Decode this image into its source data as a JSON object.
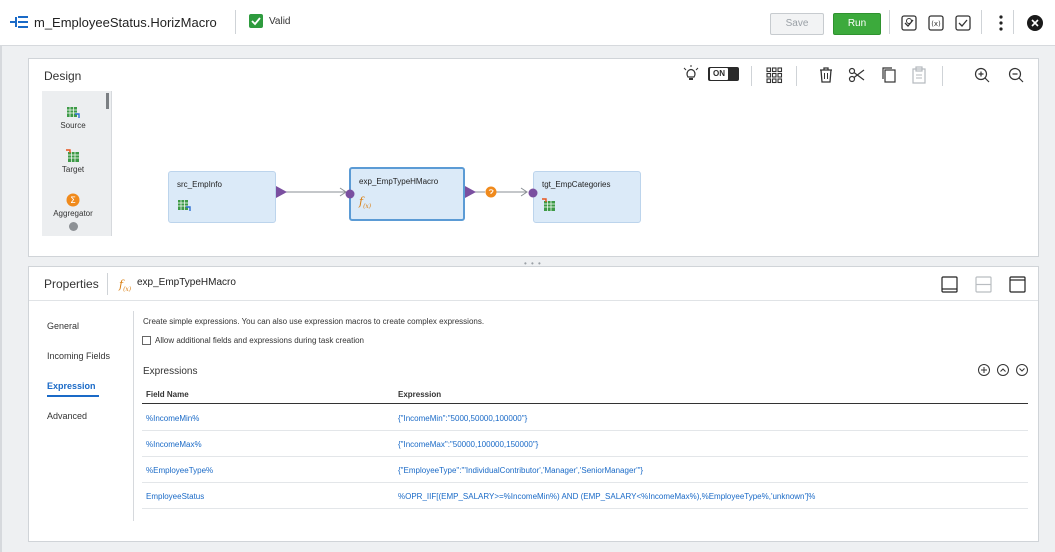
{
  "header": {
    "title": "m_EmployeeStatus.HorizMacro",
    "status_label": "Valid",
    "save_label": "Save",
    "run_label": "Run",
    "icons": [
      "mapping-icon",
      "valid-check-icon",
      "task-icon",
      "parameters-icon",
      "validate-icon",
      "more-icon",
      "close-icon"
    ]
  },
  "design": {
    "label": "Design",
    "toggle_label": "ON",
    "palette": [
      {
        "label": "Source",
        "icon": "source-icon"
      },
      {
        "label": "Target",
        "icon": "target-icon"
      },
      {
        "label": "Aggregator",
        "icon": "aggregator-icon"
      }
    ],
    "nodes": [
      {
        "label": "src_EmpInfo",
        "icon": "source-icon"
      },
      {
        "label": "exp_EmpTypeHMacro",
        "icon": "expression-icon"
      },
      {
        "label": "tgt_EmpCategories",
        "icon": "target-icon"
      }
    ],
    "colors": {
      "node_bg": "#dbeaf8",
      "port": "#7a4fa0",
      "link_orange": "#f08a1c",
      "selected_border": "#5b9bd5"
    }
  },
  "properties": {
    "label": "Properties",
    "object_name": "exp_EmpTypeHMacro",
    "tabs": [
      {
        "label": "General"
      },
      {
        "label": "Incoming Fields"
      },
      {
        "label": "Expression"
      },
      {
        "label": "Advanced"
      }
    ],
    "active_tab": "Expression",
    "description": "Create simple expressions. You can also use expression macros to create complex expressions.",
    "checkbox_label": "Allow additional fields and expressions during task creation",
    "checkbox_checked": false,
    "expressions_title": "Expressions",
    "columns": {
      "name": "Field Name",
      "expression": "Expression"
    },
    "rows": [
      {
        "name": "%IncomeMin%",
        "expression": "{\"IncomeMin\":\"5000,50000,100000\"}"
      },
      {
        "name": "%IncomeMax%",
        "expression": "{\"IncomeMax\":\"50000,100000,150000\"}"
      },
      {
        "name": "%EmployeeType%",
        "expression": "{\"EmployeeType\":\"'IndividualContributor','Manager','SeniorManager'\"}"
      },
      {
        "name": "EmployeeStatus",
        "expression": "%OPR_IIF[(EMP_SALARY>=%IncomeMin%) AND (EMP_SALARY<%IncomeMax%),%EmployeeType%,'unknown']%"
      }
    ]
  }
}
